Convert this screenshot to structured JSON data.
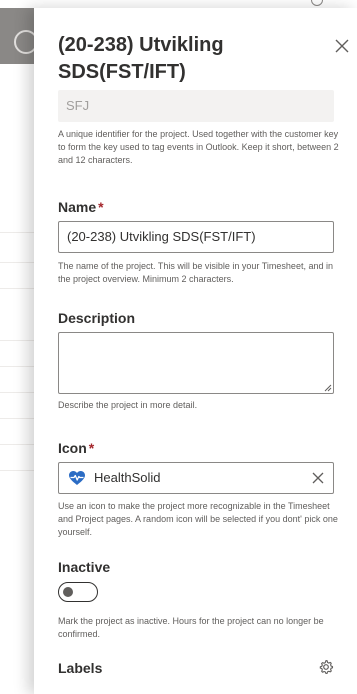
{
  "panel": {
    "title": "(20-238) Utvikling SDS(FST/IFT)"
  },
  "key": {
    "value": "SFJ",
    "help": "A unique identifier for the project. Used together with the customer key to form the key used to tag events in Outlook. Keep it short, between 2 and 12 characters."
  },
  "name": {
    "label": "Name",
    "required_marker": "*",
    "value": "(20-238) Utvikling SDS(FST/IFT)",
    "help": "The name of the project. This will be visible in your Timesheet, and in the project overview. Minimum 2 characters."
  },
  "description": {
    "label": "Description",
    "value": "",
    "help": "Describe the project in more detail."
  },
  "icon": {
    "label": "Icon",
    "required_marker": "*",
    "value": "HealthSolid",
    "icon_name": "heart-pulse-icon",
    "icon_color": "#2b6cc4",
    "help": "Use an icon to make the project more recognizable in the Timesheet and Project pages. A random icon will be selected if you dont' pick one yourself."
  },
  "inactive": {
    "label": "Inactive",
    "checked": false,
    "help": "Mark the project as inactive. Hours for the project can no longer be confirmed."
  },
  "labels": {
    "label": "Labels"
  }
}
